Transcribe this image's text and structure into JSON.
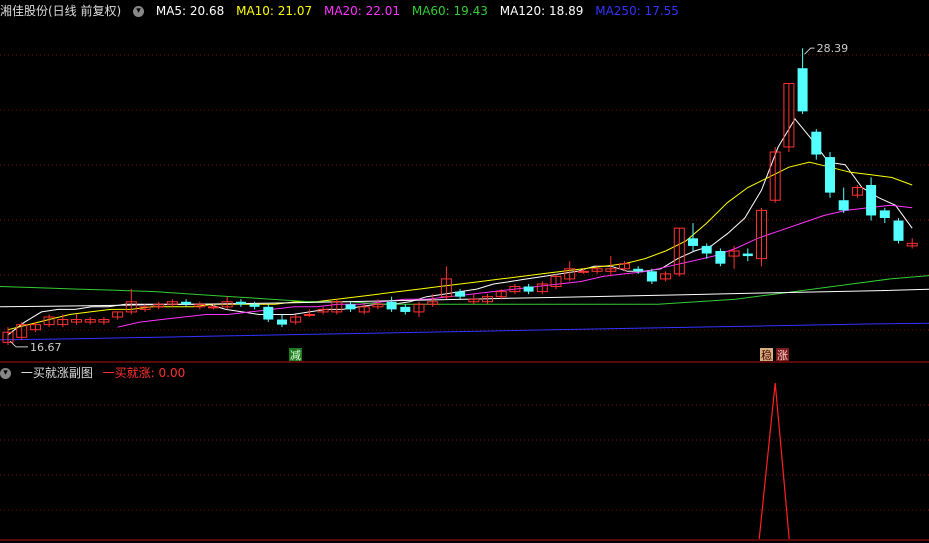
{
  "header": {
    "stock": "湘佳股份(日线 前复权)",
    "ma": [
      {
        "label": "MA5: 20.68",
        "color": "#ffffff"
      },
      {
        "label": "MA10: 21.07",
        "color": "#ffff00"
      },
      {
        "label": "MA20: 22.01",
        "color": "#ff33ff"
      },
      {
        "label": "MA60: 19.43",
        "color": "#33cc33"
      },
      {
        "label": "MA120: 18.89",
        "color": "#ffffff"
      },
      {
        "label": "MA250: 17.55",
        "color": "#3333ff"
      }
    ]
  },
  "sub": {
    "title": "一买就涨副图",
    "indicator": "一买就涨: 0.00"
  },
  "markers": {
    "jian": "减",
    "wen": "稳",
    "zhang": "涨"
  },
  "chart_data": {
    "type": "candlestick",
    "high_label": "28.39",
    "low_label": "16.67",
    "ylim": [
      16.5,
      29.5
    ],
    "candles": [
      [
        16.8,
        17.2,
        16.7,
        17.4
      ],
      [
        17.0,
        17.5,
        16.9,
        17.6
      ],
      [
        17.3,
        17.5,
        17.2,
        17.6
      ],
      [
        17.5,
        17.8,
        17.4,
        17.9
      ],
      [
        17.5,
        17.7,
        17.4,
        17.9
      ],
      [
        17.6,
        17.7,
        17.5,
        17.9
      ],
      [
        17.6,
        17.7,
        17.5,
        17.8
      ],
      [
        17.6,
        17.7,
        17.5,
        17.8
      ],
      [
        17.8,
        18.0,
        17.7,
        18.0
      ],
      [
        18.0,
        18.4,
        17.9,
        18.9
      ],
      [
        18.1,
        18.2,
        18.0,
        18.3
      ],
      [
        18.2,
        18.3,
        18.1,
        18.4
      ],
      [
        18.3,
        18.4,
        18.2,
        18.5
      ],
      [
        18.4,
        18.3,
        18.2,
        18.5
      ],
      [
        18.2,
        18.3,
        18.1,
        18.4
      ],
      [
        18.2,
        18.2,
        18.1,
        18.3
      ],
      [
        18.2,
        18.4,
        18.1,
        18.6
      ],
      [
        18.4,
        18.3,
        18.2,
        18.5
      ],
      [
        18.3,
        18.2,
        18.1,
        18.4
      ],
      [
        18.2,
        17.7,
        17.6,
        18.3
      ],
      [
        17.7,
        17.5,
        17.4,
        17.9
      ],
      [
        17.6,
        17.8,
        17.5,
        17.9
      ],
      [
        17.9,
        17.9,
        17.8,
        18.1
      ],
      [
        18.0,
        18.1,
        17.9,
        18.2
      ],
      [
        18.0,
        18.4,
        17.9,
        18.5
      ],
      [
        18.3,
        18.1,
        18.0,
        18.4
      ],
      [
        18.0,
        18.2,
        17.9,
        18.3
      ],
      [
        18.2,
        18.3,
        18.1,
        18.5
      ],
      [
        18.4,
        18.1,
        18.0,
        18.6
      ],
      [
        18.2,
        18.0,
        17.9,
        18.3
      ],
      [
        18.0,
        18.3,
        17.8,
        18.4
      ],
      [
        18.3,
        18.4,
        18.2,
        18.7
      ],
      [
        18.6,
        19.3,
        18.5,
        19.8
      ],
      [
        18.8,
        18.6,
        18.5,
        18.9
      ],
      [
        18.4,
        18.5,
        18.3,
        18.7
      ],
      [
        18.4,
        18.6,
        18.3,
        18.7
      ],
      [
        18.6,
        18.8,
        18.5,
        18.9
      ],
      [
        18.8,
        19.0,
        18.7,
        19.1
      ],
      [
        19.0,
        18.8,
        18.7,
        19.1
      ],
      [
        18.8,
        19.1,
        18.7,
        19.2
      ],
      [
        19.0,
        19.4,
        18.9,
        19.5
      ],
      [
        19.3,
        19.7,
        19.2,
        20.0
      ],
      [
        19.6,
        19.6,
        19.5,
        19.7
      ],
      [
        19.6,
        19.7,
        19.5,
        19.8
      ],
      [
        19.6,
        19.7,
        19.4,
        20.2
      ],
      [
        19.7,
        19.9,
        19.6,
        20.0
      ],
      [
        19.7,
        19.6,
        19.5,
        19.8
      ],
      [
        19.6,
        19.2,
        19.1,
        19.7
      ],
      [
        19.3,
        19.5,
        19.2,
        19.6
      ],
      [
        19.5,
        21.3,
        19.4,
        21.3
      ],
      [
        20.9,
        20.6,
        20.4,
        21.5
      ],
      [
        20.6,
        20.3,
        20.1,
        20.7
      ],
      [
        20.4,
        19.9,
        19.8,
        20.5
      ],
      [
        20.2,
        20.4,
        19.7,
        20.6
      ],
      [
        20.3,
        20.2,
        20.0,
        20.5
      ],
      [
        20.1,
        22.0,
        19.8,
        22.1
      ],
      [
        22.4,
        24.3,
        22.3,
        24.5
      ],
      [
        24.5,
        27.0,
        24.3,
        27.0
      ],
      [
        27.6,
        25.9,
        25.8,
        28.39
      ],
      [
        25.1,
        24.2,
        24.0,
        25.2
      ],
      [
        24.1,
        22.7,
        22.5,
        24.3
      ],
      [
        22.4,
        22.0,
        21.9,
        22.9
      ],
      [
        22.6,
        22.9,
        22.5,
        23.0
      ],
      [
        23.0,
        21.8,
        21.6,
        23.3
      ],
      [
        22.0,
        21.7,
        21.5,
        22.1
      ],
      [
        21.6,
        20.8,
        20.7,
        21.7
      ],
      [
        20.6,
        20.7,
        20.5,
        20.9
      ]
    ],
    "ma_series": [
      {
        "name": "MA5",
        "color": "#ffffff",
        "values": [
          17.1,
          17.6,
          18.0,
          18.1,
          18.1,
          18.2,
          18.2,
          18.3,
          18.3,
          18.3,
          18.3,
          18.3,
          18.3,
          18.1,
          18.0,
          17.9,
          17.9,
          17.9,
          18.0,
          18.1,
          18.1,
          18.2,
          18.3,
          18.3,
          18.4,
          18.6,
          18.7,
          18.8,
          18.9,
          19.1,
          19.2,
          19.3,
          19.4,
          19.5,
          19.6,
          19.8,
          19.8,
          19.6,
          19.6,
          19.7,
          20.1,
          20.4,
          20.6,
          21.1,
          21.7,
          22.8,
          24.5,
          25.6,
          24.8,
          23.9,
          23.8,
          22.9,
          22.5,
          22.2,
          21.3
        ]
      },
      {
        "name": "MA10",
        "color": "#ffff00",
        "values": [
          17.3,
          17.5,
          17.7,
          17.9,
          18.0,
          18.1,
          18.1,
          18.2,
          18.2,
          18.2,
          18.3,
          18.3,
          18.3,
          18.3,
          18.4,
          18.4,
          18.5,
          18.6,
          18.7,
          18.8,
          18.9,
          19.0,
          19.1,
          19.2,
          19.3,
          19.4,
          19.5,
          19.6,
          19.7,
          19.8,
          19.9,
          20.1,
          20.4,
          20.8,
          21.5,
          22.3,
          22.9,
          23.3,
          23.7,
          23.9,
          23.7,
          23.5,
          23.4,
          23.3,
          23.0
        ]
      },
      {
        "name": "MA20",
        "color": "#ff33ff",
        "values": [
          17.4,
          17.6,
          17.7,
          17.8,
          17.9,
          17.9,
          18.0,
          18.1,
          18.2,
          18.2,
          18.3,
          18.3,
          18.4,
          18.5,
          18.5,
          18.6,
          18.7,
          18.8,
          18.9,
          19.0,
          19.1,
          19.2,
          19.4,
          19.5,
          19.6,
          19.8,
          20.0,
          20.2,
          20.5,
          20.9,
          21.2,
          21.5,
          21.8,
          22.0,
          22.1,
          22.2,
          22.1
        ]
      },
      {
        "name": "MA60",
        "color": "#33cc33",
        "values": [
          19.0,
          18.95,
          18.9,
          18.85,
          18.8,
          18.7,
          18.6,
          18.5,
          18.4,
          18.4,
          18.3,
          18.3,
          18.3,
          18.3,
          18.3,
          18.3,
          18.3,
          18.3,
          18.4,
          18.5,
          18.7,
          18.9,
          19.1,
          19.3,
          19.43
        ]
      },
      {
        "name": "MA120",
        "color": "#ffffff",
        "values": [
          18.2,
          18.22,
          18.25,
          18.28,
          18.3,
          18.33,
          18.36,
          18.4,
          18.44,
          18.48,
          18.52,
          18.56,
          18.6,
          18.64,
          18.68,
          18.72,
          18.76,
          18.8,
          18.84,
          18.89
        ]
      },
      {
        "name": "MA250",
        "color": "#3333ff",
        "values": [
          16.9,
          16.93,
          16.97,
          17.01,
          17.05,
          17.09,
          17.13,
          17.17,
          17.21,
          17.25,
          17.29,
          17.33,
          17.37,
          17.41,
          17.45,
          17.49,
          17.53,
          17.55
        ]
      }
    ],
    "indicator_series": {
      "name": "一买就涨",
      "color": "#ff2020",
      "signal_index": 56,
      "value": 0.0
    }
  }
}
